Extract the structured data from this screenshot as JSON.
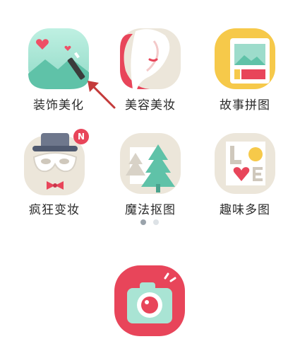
{
  "tiles": [
    {
      "label": "装饰美化",
      "icon": "decorate-icon"
    },
    {
      "label": "美容美妆",
      "icon": "beauty-makeup-icon"
    },
    {
      "label": "故事拼图",
      "icon": "story-collage-icon"
    },
    {
      "label": "疯狂变妆",
      "icon": "crazy-makeover-icon",
      "badge": "N"
    },
    {
      "label": "魔法抠图",
      "icon": "magic-cutout-icon"
    },
    {
      "label": "趣味多图",
      "icon": "fun-multi-photo-icon"
    }
  ],
  "pager": {
    "current": 1,
    "total": 2
  },
  "colors": {
    "accent": "#e8455a",
    "mint": "#8fd9c6",
    "gray": "#e6e2da"
  },
  "camera": {
    "icon": "camera-icon"
  }
}
